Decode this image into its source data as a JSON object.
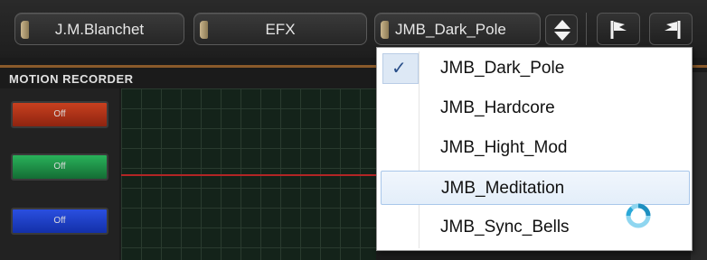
{
  "toolbar": {
    "preset_1": "J.M.Blanchet",
    "preset_2": "EFX",
    "preset_3": "JMB_Dark_Pole"
  },
  "panel": {
    "title": "MOTION RECORDER",
    "buttons": [
      {
        "label": "Off",
        "color": "#b83317"
      },
      {
        "label": "Off",
        "color": "#1f9a4a"
      },
      {
        "label": "Off",
        "color": "#1b3fd0"
      }
    ]
  },
  "menu": {
    "items": [
      {
        "label": "JMB_Dark_Pole",
        "checked": true
      },
      {
        "label": "JMB_Hardcore",
        "checked": false
      },
      {
        "label": "JMB_Hight_Mod",
        "checked": false
      },
      {
        "label": "JMB_Meditation",
        "checked": false,
        "hovered": true
      },
      {
        "label": "JMB_Sync_Bells",
        "checked": false
      }
    ],
    "check_glyph": "✓"
  },
  "icons": {
    "stepper": "up-down-stepper-icon",
    "tool_1": "flag-forward-icon",
    "tool_2": "flag-back-icon",
    "cursor": "busy-cursor-icon"
  }
}
